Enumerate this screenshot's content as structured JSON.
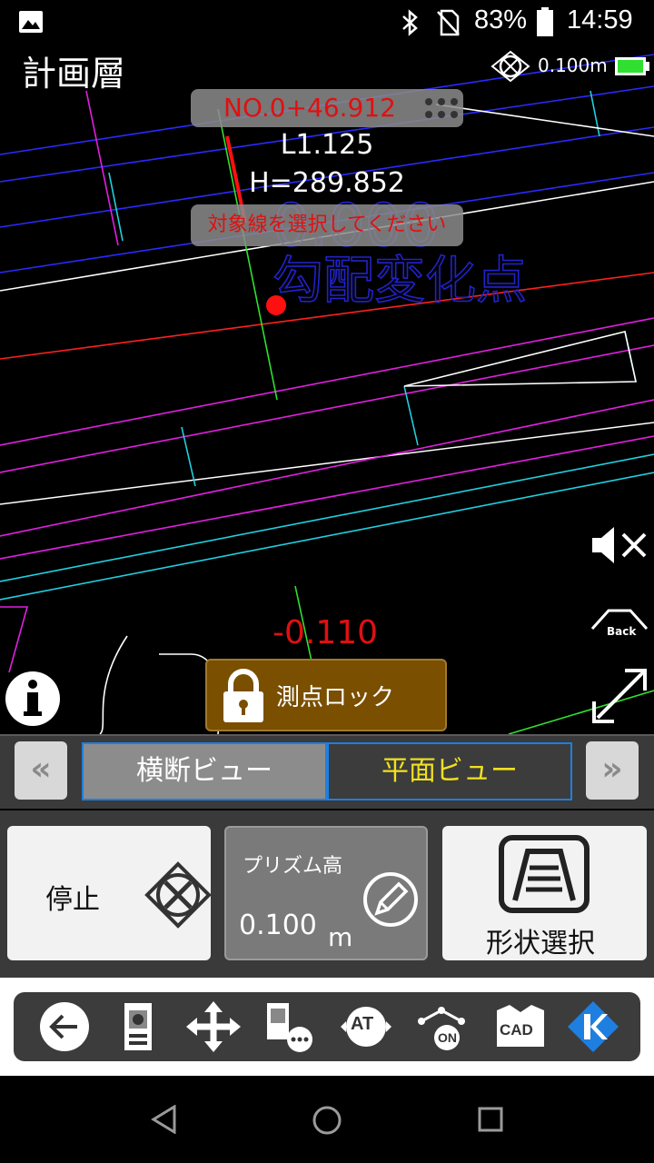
{
  "status_bar": {
    "battery": "83%",
    "time": "14:59"
  },
  "header": {
    "title": "計画層",
    "prism_scale": "0.100m"
  },
  "overlay": {
    "station": "NO.0+46.912",
    "offset": "L1.125",
    "height": "H=289.852",
    "message": "対象線を選択してください",
    "bg_label_top": "0.000",
    "bg_label_bottom": "勾配変化点",
    "delta": "-0.110",
    "lock_label": "測点ロック"
  },
  "view_tabs": {
    "cross": "横断ビュー",
    "plan": "平面ビュー"
  },
  "actions": {
    "stop": "停止",
    "prism_title": "プリズム高",
    "prism_value": "0.100",
    "prism_unit": "m",
    "shape_select": "形状選択"
  },
  "side": {
    "back_label": "Back"
  },
  "toolbar": {
    "at_label": "AT",
    "on_label": "ON",
    "cad_label": "CAD"
  },
  "colors": {
    "accent_blue": "#1e7fe0",
    "lock_brown": "#7a4f00",
    "red_text": "#e01010",
    "yellow_tab": "#f0e020"
  }
}
